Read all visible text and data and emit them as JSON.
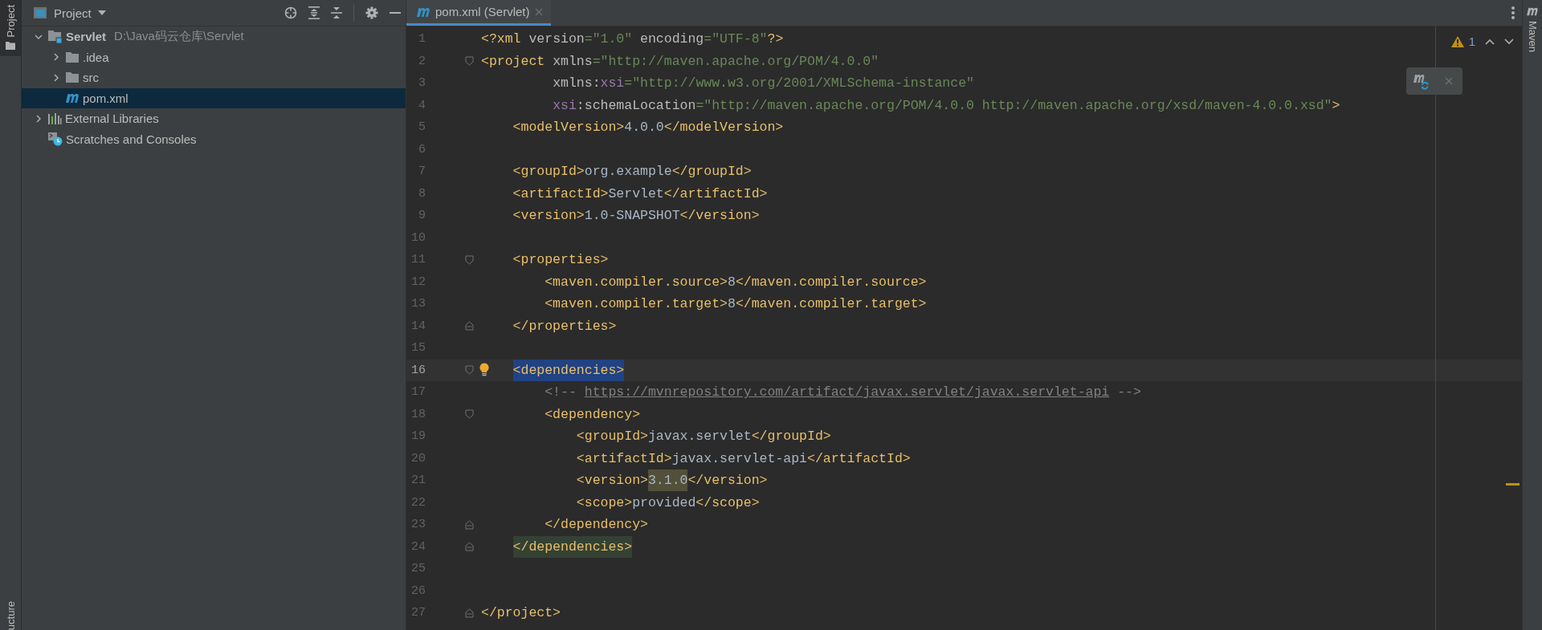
{
  "left_strip": {
    "tabs": [
      {
        "label": "Project",
        "selected": true
      },
      {
        "label": "ucture",
        "selected": false
      }
    ]
  },
  "project_panel": {
    "title": "Project",
    "tree": [
      {
        "label": "Servlet",
        "path": "D:\\Java码云仓库\\Servlet",
        "kind": "module",
        "expanded": true,
        "selected": false,
        "children": [
          {
            "label": ".idea",
            "kind": "folder",
            "expanded": false,
            "selected": false
          },
          {
            "label": "src",
            "kind": "folder",
            "expanded": false,
            "selected": false
          },
          {
            "label": "pom.xml",
            "kind": "maven",
            "selected": true
          }
        ]
      },
      {
        "label": "External Libraries",
        "kind": "libraries",
        "expanded": false,
        "selected": false
      },
      {
        "label": "Scratches and Consoles",
        "kind": "scratches",
        "selected": false
      }
    ]
  },
  "editor": {
    "tabs": [
      {
        "label": "pom.xml (Servlet)",
        "selected": true
      }
    ],
    "warnings": "1",
    "lines": [
      {
        "number": "1",
        "tokens": [
          {
            "kind": "tag",
            "text": "<?xml "
          },
          {
            "kind": "attr",
            "text": "version"
          },
          {
            "kind": "string",
            "text": "=\"1.0\" "
          },
          {
            "kind": "attr",
            "text": "encoding"
          },
          {
            "kind": "string",
            "text": "=\"UTF-8\""
          },
          {
            "kind": "tag",
            "text": "?>"
          }
        ]
      },
      {
        "number": "2",
        "fold_open": true,
        "tokens": [
          {
            "kind": "tag",
            "text": "<project "
          },
          {
            "kind": "attr",
            "text": "xmlns"
          },
          {
            "kind": "string",
            "text": "=\"http://maven.apache.org/POM/4.0.0\""
          }
        ]
      },
      {
        "number": "3",
        "tokens": [
          {
            "kind": "attr",
            "text": "         xmlns:"
          },
          {
            "kind": "ns",
            "text": "xsi"
          },
          {
            "kind": "string",
            "text": "=\"http://www.w3.org/2001/XMLSchema-instance\""
          }
        ]
      },
      {
        "number": "4",
        "tokens": [
          {
            "kind": "ns",
            "text": "         xsi"
          },
          {
            "kind": "attr",
            "text": ":schemaLocation"
          },
          {
            "kind": "string",
            "text": "=\"http://maven.apache.org/POM/4.0.0 http://maven.apache.org/xsd/maven-4.0.0.xsd\""
          },
          {
            "kind": "tag",
            "text": ">"
          }
        ]
      },
      {
        "number": "5",
        "tokens": [
          {
            "kind": "tag",
            "text": "    <modelVersion>"
          },
          {
            "kind": "text",
            "text": "4.0.0"
          },
          {
            "kind": "tag",
            "text": "</modelVersion>"
          }
        ]
      },
      {
        "number": "6"
      },
      {
        "number": "7",
        "tokens": [
          {
            "kind": "tag",
            "text": "    <groupId>"
          },
          {
            "kind": "text",
            "text": "org.example"
          },
          {
            "kind": "tag",
            "text": "</groupId>"
          }
        ]
      },
      {
        "number": "8",
        "tokens": [
          {
            "kind": "tag",
            "text": "    <artifactId>"
          },
          {
            "kind": "text",
            "text": "Servlet"
          },
          {
            "kind": "tag",
            "text": "</artifactId>"
          }
        ]
      },
      {
        "number": "9",
        "tokens": [
          {
            "kind": "tag",
            "text": "    <version>"
          },
          {
            "kind": "text",
            "text": "1.0-SNAPSHOT"
          },
          {
            "kind": "tag",
            "text": "</version>"
          }
        ]
      },
      {
        "number": "10"
      },
      {
        "number": "11",
        "fold_open": true,
        "tokens": [
          {
            "kind": "tag",
            "text": "    <properties>"
          }
        ]
      },
      {
        "number": "12",
        "tokens": [
          {
            "kind": "tag",
            "text": "        <maven.compiler.source>"
          },
          {
            "kind": "text",
            "text": "8"
          },
          {
            "kind": "tag",
            "text": "</maven.compiler.source>"
          }
        ]
      },
      {
        "number": "13",
        "tokens": [
          {
            "kind": "tag",
            "text": "        <maven.compiler.target>"
          },
          {
            "kind": "text",
            "text": "8"
          },
          {
            "kind": "tag",
            "text": "</maven.compiler.target>"
          }
        ]
      },
      {
        "number": "14",
        "fold_close": true,
        "tokens": [
          {
            "kind": "tag",
            "text": "    </properties>"
          }
        ]
      },
      {
        "number": "15"
      },
      {
        "number": "16",
        "current": true,
        "bulb": true,
        "fold_open": true,
        "tokens": [
          {
            "kind": "tag",
            "text": "    <dependencies>",
            "selected": true
          }
        ]
      },
      {
        "number": "17",
        "tokens": [
          {
            "kind": "comment",
            "text": "        <!-- "
          },
          {
            "kind": "link",
            "text": "https://mvnrepository.com/artifact/javax.servlet/javax.servlet-api"
          },
          {
            "kind": "comment",
            "text": " -->"
          }
        ]
      },
      {
        "number": "18",
        "fold_open": true,
        "tokens": [
          {
            "kind": "tag",
            "text": "        <dependency>"
          }
        ]
      },
      {
        "number": "19",
        "tokens": [
          {
            "kind": "tag",
            "text": "            <groupId>"
          },
          {
            "kind": "text",
            "text": "javax.servlet"
          },
          {
            "kind": "tag",
            "text": "</groupId>"
          }
        ]
      },
      {
        "number": "20",
        "tokens": [
          {
            "kind": "tag",
            "text": "            <artifactId>"
          },
          {
            "kind": "text",
            "text": "javax.servlet-api"
          },
          {
            "kind": "tag",
            "text": "</artifactId>"
          }
        ]
      },
      {
        "number": "21",
        "tokens": [
          {
            "kind": "tag",
            "text": "            <version>"
          },
          {
            "kind": "text",
            "text": "3.1.0",
            "warning": true
          },
          {
            "kind": "tag",
            "text": "</version>"
          }
        ]
      },
      {
        "number": "22",
        "tokens": [
          {
            "kind": "tag",
            "text": "            <scope>"
          },
          {
            "kind": "text",
            "text": "provided"
          },
          {
            "kind": "tag",
            "text": "</scope>"
          }
        ]
      },
      {
        "number": "23",
        "fold_close": true,
        "tokens": [
          {
            "kind": "tag",
            "text": "        </dependency>"
          }
        ]
      },
      {
        "number": "24",
        "fold_close": true,
        "tokens": [
          {
            "kind": "tag",
            "text": "    </dependencies>",
            "paired": true
          }
        ]
      },
      {
        "number": "25"
      },
      {
        "number": "26"
      },
      {
        "number": "27",
        "fold_close": true,
        "tokens": [
          {
            "kind": "tag",
            "text": "</project>"
          }
        ]
      }
    ]
  },
  "right_strip": {
    "tabs": [
      {
        "label": "Maven",
        "selected": false
      }
    ]
  }
}
